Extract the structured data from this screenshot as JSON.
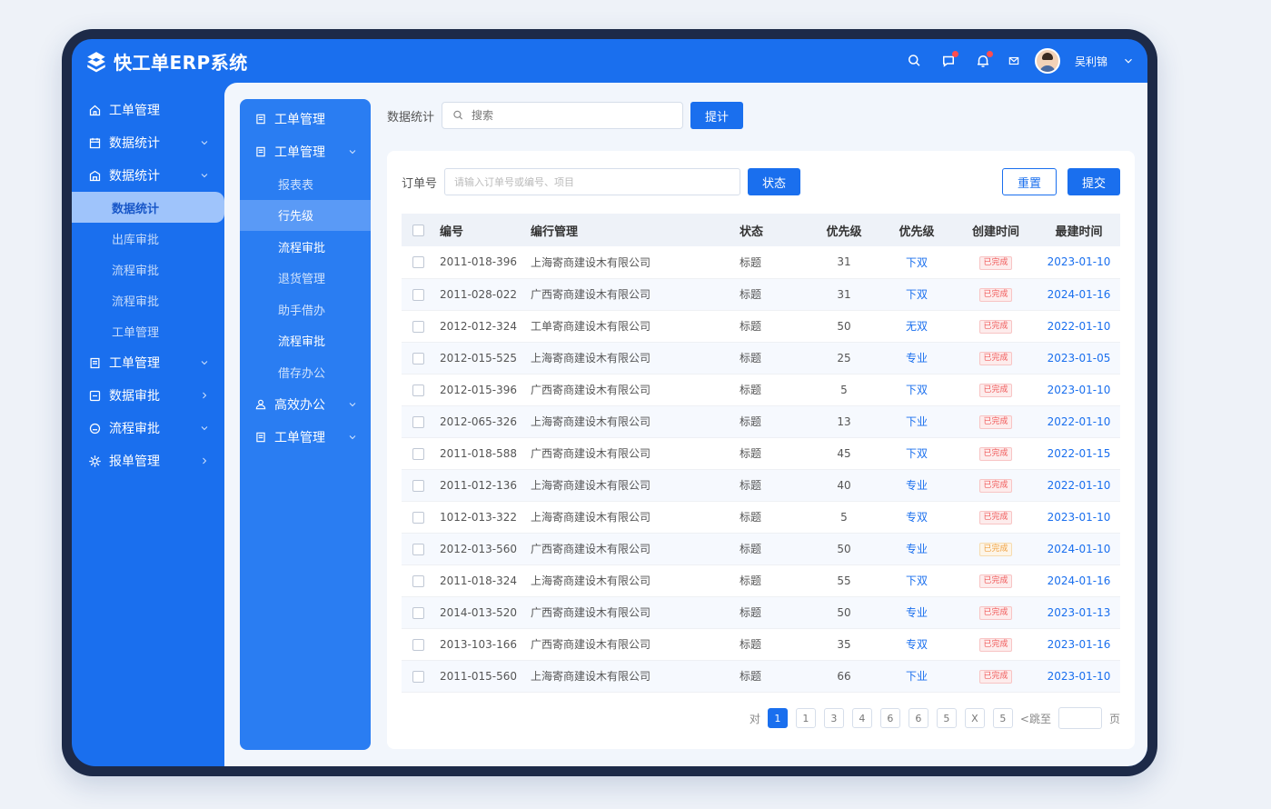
{
  "app": {
    "title": "快工单ERP系统",
    "username": "吴利锦"
  },
  "sidebar": {
    "items": [
      {
        "label": "工单管理",
        "icon": "home-icon",
        "chevron": ""
      },
      {
        "label": "数据统计",
        "icon": "calendar-icon",
        "chevron": "down"
      },
      {
        "label": "数据统计",
        "icon": "building-icon",
        "chevron": "down"
      }
    ],
    "subitems": [
      {
        "label": "数据统计",
        "active": true
      },
      {
        "label": "出库审批",
        "active": false
      },
      {
        "label": "流程审批",
        "active": false
      },
      {
        "label": "流程审批",
        "active": false
      },
      {
        "label": "工单管理",
        "active": false
      }
    ],
    "items2": [
      {
        "label": "工单管理",
        "icon": "document-icon",
        "chevron": "down"
      },
      {
        "label": "数据审批",
        "icon": "stamp-icon",
        "chevron": "right"
      },
      {
        "label": "流程审批",
        "icon": "flow-icon",
        "chevron": "down"
      },
      {
        "label": "报单管理",
        "icon": "gear-icon",
        "chevron": "right"
      }
    ]
  },
  "panel2": {
    "top": [
      {
        "label": "工单管理",
        "icon": "document-icon",
        "chevron": ""
      },
      {
        "label": "工单管理",
        "icon": "document-icon",
        "chevron": "down"
      }
    ],
    "subitems": [
      {
        "label": "报表表",
        "state": ""
      },
      {
        "label": "行先级",
        "state": "active"
      },
      {
        "label": "流程审批",
        "state": "bright"
      },
      {
        "label": "退货管理",
        "state": ""
      },
      {
        "label": "助手借办",
        "state": ""
      },
      {
        "label": "流程审批",
        "state": "bright"
      },
      {
        "label": "借存办公",
        "state": ""
      }
    ],
    "bottom": [
      {
        "label": "高效办公",
        "icon": "user-icon",
        "chevron": "down"
      },
      {
        "label": "工单管理",
        "icon": "document-icon",
        "chevron": "down"
      }
    ]
  },
  "search": {
    "label": "数据统计",
    "placeholder": "搜索",
    "button": "提计"
  },
  "filter": {
    "label": "订单号",
    "placeholder": "请输入订单号或编号、项目",
    "state_button": "状态",
    "reset_button": "重置",
    "submit_button": "提交"
  },
  "table": {
    "headers": [
      "编号",
      "编行管理",
      "状态",
      "优先级",
      "优先级",
      "创建时间",
      "最建时间"
    ],
    "rows": [
      {
        "id": "2011-018-396",
        "company": "上海寄商建设木有限公司",
        "status": "标题",
        "score": "31",
        "priority": "下双",
        "tag": "已完成",
        "tagColor": "red",
        "date": "2023-01-10"
      },
      {
        "id": "2011-028-022",
        "company": "广西寄商建设木有限公司",
        "status": "标题",
        "score": "31",
        "priority": "下双",
        "tag": "已完成",
        "tagColor": "red",
        "date": "2024-01-16"
      },
      {
        "id": "2012-012-324",
        "company": "工单寄商建设木有限公司",
        "status": "标题",
        "score": "50",
        "priority": "无双",
        "tag": "已完成",
        "tagColor": "red",
        "date": "2022-01-10"
      },
      {
        "id": "2012-015-525",
        "company": "上海寄商建设木有限公司",
        "status": "标题",
        "score": "25",
        "priority": "专业",
        "tag": "已完成",
        "tagColor": "red",
        "date": "2023-01-05"
      },
      {
        "id": "2012-015-396",
        "company": "广西寄商建设木有限公司",
        "status": "标题",
        "score": "5",
        "priority": "下双",
        "tag": "已完成",
        "tagColor": "red",
        "date": "2023-01-10"
      },
      {
        "id": "2012-065-326",
        "company": "上海寄商建设木有限公司",
        "status": "标题",
        "score": "13",
        "priority": "下业",
        "tag": "已完成",
        "tagColor": "red",
        "date": "2022-01-10"
      },
      {
        "id": "2011-018-588",
        "company": "广西寄商建设木有限公司",
        "status": "标题",
        "score": "45",
        "priority": "下双",
        "tag": "已完成",
        "tagColor": "red",
        "date": "2022-01-15"
      },
      {
        "id": "2011-012-136",
        "company": "上海寄商建设木有限公司",
        "status": "标题",
        "score": "40",
        "priority": "专业",
        "tag": "已完成",
        "tagColor": "red",
        "date": "2022-01-10"
      },
      {
        "id": "1012-013-322",
        "company": "上海寄商建设木有限公司",
        "status": "标题",
        "score": "5",
        "priority": "专双",
        "tag": "已完成",
        "tagColor": "red",
        "date": "2023-01-10"
      },
      {
        "id": "2012-013-560",
        "company": "广西寄商建设木有限公司",
        "status": "标题",
        "score": "50",
        "priority": "专业",
        "tag": "已完成",
        "tagColor": "orange",
        "date": "2024-01-10"
      },
      {
        "id": "2011-018-324",
        "company": "上海寄商建设木有限公司",
        "status": "标题",
        "score": "55",
        "priority": "下双",
        "tag": "已完成",
        "tagColor": "red",
        "date": "2024-01-16"
      },
      {
        "id": "2014-013-520",
        "company": "广西寄商建设木有限公司",
        "status": "标题",
        "score": "50",
        "priority": "专业",
        "tag": "已完成",
        "tagColor": "red",
        "date": "2023-01-13"
      },
      {
        "id": "2013-103-166",
        "company": "广西寄商建设木有限公司",
        "status": "标题",
        "score": "35",
        "priority": "专双",
        "tag": "已完成",
        "tagColor": "red",
        "date": "2023-01-16"
      },
      {
        "id": "2011-015-560",
        "company": "上海寄商建设木有限公司",
        "status": "标题",
        "score": "66",
        "priority": "下业",
        "tag": "已完成",
        "tagColor": "red",
        "date": "2023-01-10"
      }
    ]
  },
  "pagination": {
    "prev": "对",
    "pages": [
      "1",
      "1",
      "3",
      "4",
      "6",
      "6",
      "5",
      "X",
      "5"
    ],
    "current_index": 0,
    "goto_label": "<跳至",
    "suffix": "页"
  },
  "colors": {
    "primary": "#1a6fee",
    "frame": "#1d2a48"
  }
}
